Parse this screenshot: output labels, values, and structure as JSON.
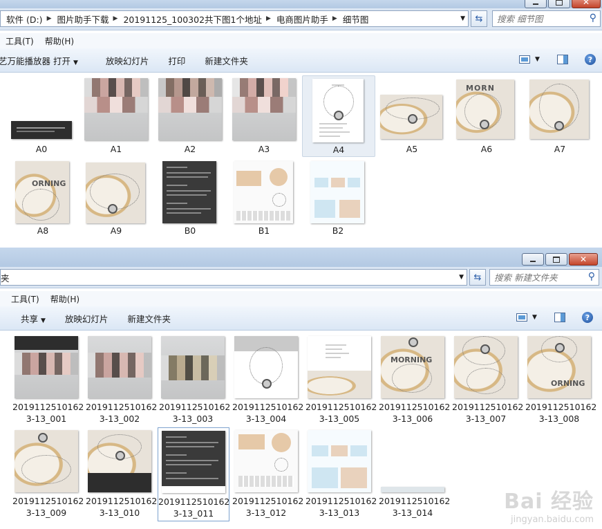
{
  "window1": {
    "breadcrumb": [
      "软件 (D:)",
      "图片助手下载",
      "20191125_100302共下图1个地址",
      "电商图片助手",
      "细节图"
    ],
    "search_placeholder": "搜索 细节图",
    "menu": [
      "工具(T)",
      "帮助(H)"
    ],
    "toolbar": [
      "艺万能播放器 打开",
      "放映幻灯片",
      "打印",
      "新建文件夹"
    ],
    "items": [
      "A0",
      "A1",
      "A2",
      "A3",
      "A4",
      "A5",
      "A6",
      "A7",
      "A8",
      "A9",
      "B0",
      "B1",
      "B2"
    ],
    "selected": "A4"
  },
  "window2": {
    "address_fragment": "夹",
    "search_placeholder": "搜索 新建文件夹",
    "menu": [
      "工具(T)",
      "帮助(H)"
    ],
    "toolbar": [
      "共享",
      "放映幻灯片",
      "新建文件夹"
    ],
    "items": [
      [
        "20191125101623-13_001",
        "20191125101623-13_002",
        "20191125101623-13_003",
        "20191125101623-13_004",
        "20191125101623-13_005",
        "20191125101623-13_006",
        "20191125101623-13_007",
        "20191125101623-13_008"
      ],
      [
        "20191125101623-13_009",
        "20191125101623-13_010",
        "20191125101623-13_011",
        "20191125101623-13_012",
        "20191125101623-13_013",
        "20191125101623-13_014"
      ]
    ],
    "label_lines": [
      [
        [
          "2019112510162",
          "3-13_001"
        ],
        [
          "2019112510162",
          "3-13_002"
        ],
        [
          "2019112510162",
          "3-13_003"
        ],
        [
          "2019112510162",
          "3-13_004"
        ],
        [
          "2019112510162",
          "3-13_005"
        ],
        [
          "2019112510162",
          "3-13_006"
        ],
        [
          "2019112510162",
          "3-13_007"
        ],
        [
          "2019112510162",
          "3-13_008"
        ]
      ],
      [
        [
          "2019112510162",
          "3-13_009"
        ],
        [
          "2019112510162",
          "3-13_010"
        ],
        [
          "2019112510162",
          "3-13_011"
        ],
        [
          "2019112510162",
          "3-13_012"
        ],
        [
          "2019112510162",
          "3-13_013"
        ],
        [
          "2019112510162",
          "3-13_014"
        ]
      ]
    ],
    "focused": "20191125101623-13_011"
  },
  "watermark": {
    "logo": "Bai 经验",
    "url": "jingyan.baidu.com"
  },
  "icons": {
    "refresh": "refresh-icon",
    "search": "search-icon",
    "views": "views-icon",
    "preview_pane": "preview-pane-icon",
    "help": "help-icon"
  }
}
